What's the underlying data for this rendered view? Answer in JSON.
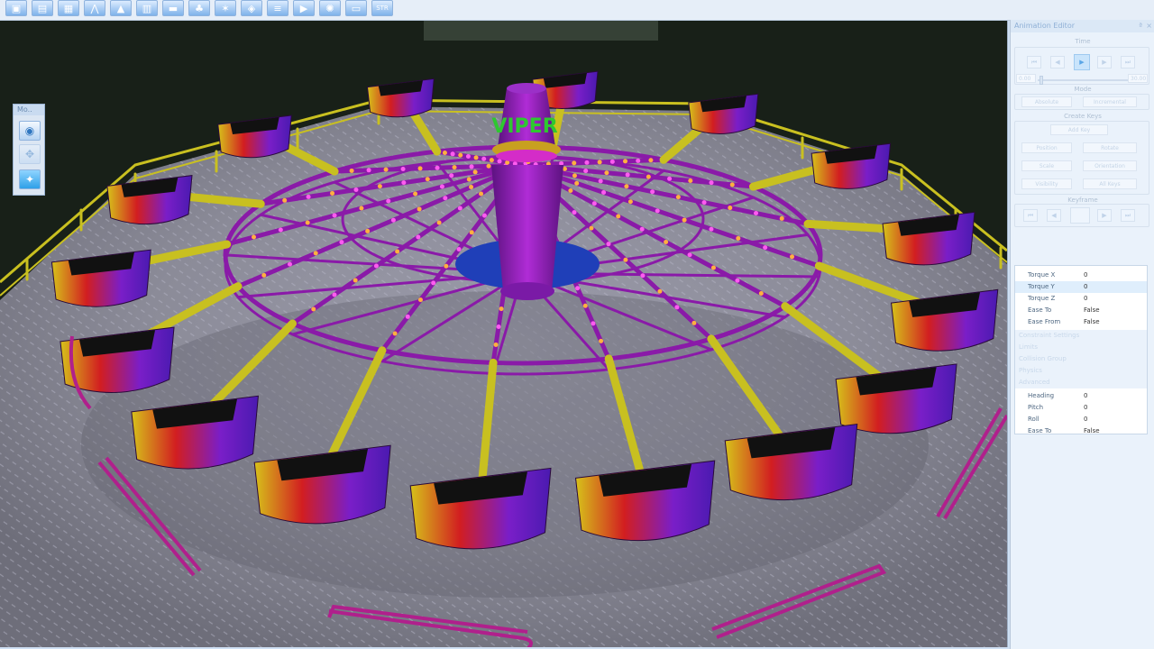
{
  "toolbar": {
    "buttons": [
      {
        "name": "save-icon",
        "glyph": "▣"
      },
      {
        "name": "open-icon",
        "glyph": "▤"
      },
      {
        "name": "grid-icon",
        "glyph": "▦"
      },
      {
        "name": "track-icon",
        "glyph": "⋀"
      },
      {
        "name": "terrain-icon",
        "glyph": "▲"
      },
      {
        "name": "building-icon",
        "glyph": "▥"
      },
      {
        "name": "vehicle-icon",
        "glyph": "▬"
      },
      {
        "name": "tree-icon",
        "glyph": "♣"
      },
      {
        "name": "light-icon",
        "glyph": "✶"
      },
      {
        "name": "path-icon",
        "glyph": "◈"
      },
      {
        "name": "list-icon",
        "glyph": "≡"
      },
      {
        "name": "film-icon",
        "glyph": "▶"
      },
      {
        "name": "settings-icon",
        "glyph": "✺"
      },
      {
        "name": "window-icon",
        "glyph": "▭"
      },
      {
        "name": "str-icon",
        "label": "STR"
      }
    ]
  },
  "mini_panel": {
    "title": "Mo..",
    "close": "×"
  },
  "animation_editor": {
    "title": "Animation Editor",
    "pin": "ª",
    "close": "×",
    "time_label": "Time",
    "time_start": "0.00",
    "time_end": "30.00",
    "mode_label": "Mode",
    "mode_buttons": [
      "Absolute",
      "Incremental"
    ],
    "create_keys_label": "Create Keys",
    "create_keys_button": "Add Key",
    "key_buttons": [
      "Position",
      "Rotate",
      "Scale",
      "Orientation",
      "Visibility",
      "All Keys"
    ],
    "keyframe_label": "Keyframe",
    "properties": [
      {
        "key": "Torque X",
        "value": "0",
        "state": "normal"
      },
      {
        "key": "Torque Y",
        "value": "0",
        "state": "selected"
      },
      {
        "key": "Torque Z",
        "value": "0",
        "state": "normal"
      },
      {
        "key": "Ease To",
        "value": "False",
        "state": "normal"
      },
      {
        "key": "Ease From",
        "value": "False",
        "state": "normal"
      }
    ],
    "categories": [
      "Constraint Settings",
      "Limits",
      "Collision Group",
      "Physics",
      "Advanced"
    ],
    "properties2": [
      {
        "key": "Heading",
        "value": "0"
      },
      {
        "key": "Pitch",
        "value": "0"
      },
      {
        "key": "Roll",
        "value": "0"
      },
      {
        "key": "Ease To",
        "value": "False"
      }
    ]
  },
  "ride": {
    "sign_text": "VIPER"
  },
  "colors": {
    "ride_purple": "#8a1aa8",
    "arm_yellow": "#c8c020",
    "light_pink": "#ff5cf0",
    "light_orange": "#ffb040",
    "floor": "#8d8d99",
    "accent": "#5aa6e6"
  }
}
